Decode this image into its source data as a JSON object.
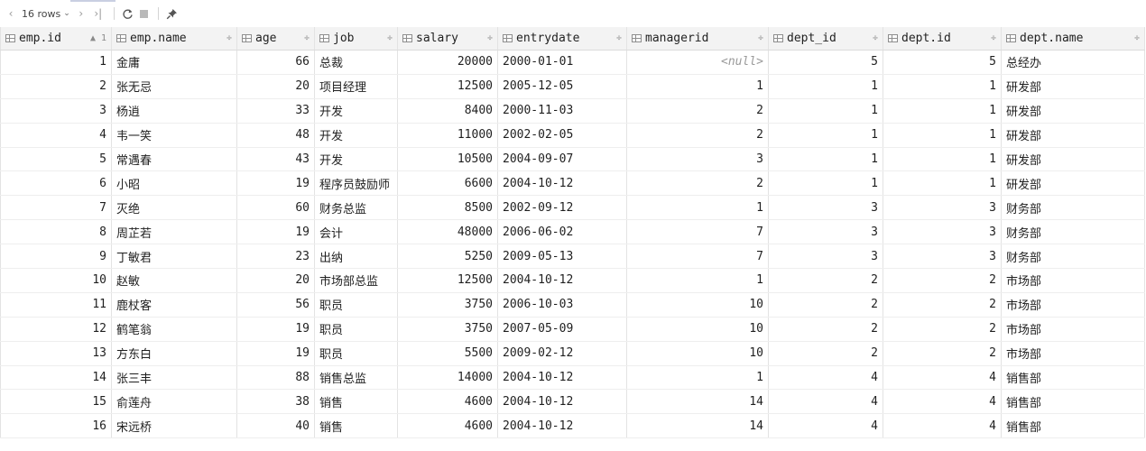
{
  "toolbar": {
    "nav_first": "‹",
    "nav_prev": "‹",
    "nav_next": "›",
    "nav_last": "›|",
    "rows_label": "16 rows",
    "rows_chevron": "⌄",
    "refresh_icon": "refresh-icon",
    "stop_icon": "stop-icon",
    "pin_icon": "pin-icon"
  },
  "columns": [
    {
      "label": "emp.id",
      "sort": "▲ 1"
    },
    {
      "label": "emp.name",
      "sort": "÷"
    },
    {
      "label": "age",
      "sort": "÷"
    },
    {
      "label": "job",
      "sort": "÷"
    },
    {
      "label": "salary",
      "sort": "÷"
    },
    {
      "label": "entrydate",
      "sort": "÷"
    },
    {
      "label": "managerid",
      "sort": "÷"
    },
    {
      "label": "dept_id",
      "sort": "÷"
    },
    {
      "label": "dept.id",
      "sort": "÷"
    },
    {
      "label": "dept.name",
      "sort": "÷"
    }
  ],
  "rows": [
    [
      "1",
      "金庸",
      "66",
      "总裁",
      "20000",
      "2000-01-01",
      "<null>",
      "5",
      "5",
      "总经办"
    ],
    [
      "2",
      "张无忌",
      "20",
      "项目经理",
      "12500",
      "2005-12-05",
      "1",
      "1",
      "1",
      "研发部"
    ],
    [
      "3",
      "杨逍",
      "33",
      "开发",
      "8400",
      "2000-11-03",
      "2",
      "1",
      "1",
      "研发部"
    ],
    [
      "4",
      "韦一笑",
      "48",
      "开发",
      "11000",
      "2002-02-05",
      "2",
      "1",
      "1",
      "研发部"
    ],
    [
      "5",
      "常遇春",
      "43",
      "开发",
      "10500",
      "2004-09-07",
      "3",
      "1",
      "1",
      "研发部"
    ],
    [
      "6",
      "小昭",
      "19",
      "程序员鼓励师",
      "6600",
      "2004-10-12",
      "2",
      "1",
      "1",
      "研发部"
    ],
    [
      "7",
      "灭绝",
      "60",
      "财务总监",
      "8500",
      "2002-09-12",
      "1",
      "3",
      "3",
      "财务部"
    ],
    [
      "8",
      "周芷若",
      "19",
      "会计",
      "48000",
      "2006-06-02",
      "7",
      "3",
      "3",
      "财务部"
    ],
    [
      "9",
      "丁敏君",
      "23",
      "出纳",
      "5250",
      "2009-05-13",
      "7",
      "3",
      "3",
      "财务部"
    ],
    [
      "10",
      "赵敏",
      "20",
      "市场部总监",
      "12500",
      "2004-10-12",
      "1",
      "2",
      "2",
      "市场部"
    ],
    [
      "11",
      "鹿杖客",
      "56",
      "职员",
      "3750",
      "2006-10-03",
      "10",
      "2",
      "2",
      "市场部"
    ],
    [
      "12",
      "鹤笔翁",
      "19",
      "职员",
      "3750",
      "2007-05-09",
      "10",
      "2",
      "2",
      "市场部"
    ],
    [
      "13",
      "方东白",
      "19",
      "职员",
      "5500",
      "2009-02-12",
      "10",
      "2",
      "2",
      "市场部"
    ],
    [
      "14",
      "张三丰",
      "88",
      "销售总监",
      "14000",
      "2004-10-12",
      "1",
      "4",
      "4",
      "销售部"
    ],
    [
      "15",
      "俞莲舟",
      "38",
      "销售",
      "4600",
      "2004-10-12",
      "14",
      "4",
      "4",
      "销售部"
    ],
    [
      "16",
      "宋远桥",
      "40",
      "销售",
      "4600",
      "2004-10-12",
      "14",
      "4",
      "4",
      "销售部"
    ]
  ]
}
